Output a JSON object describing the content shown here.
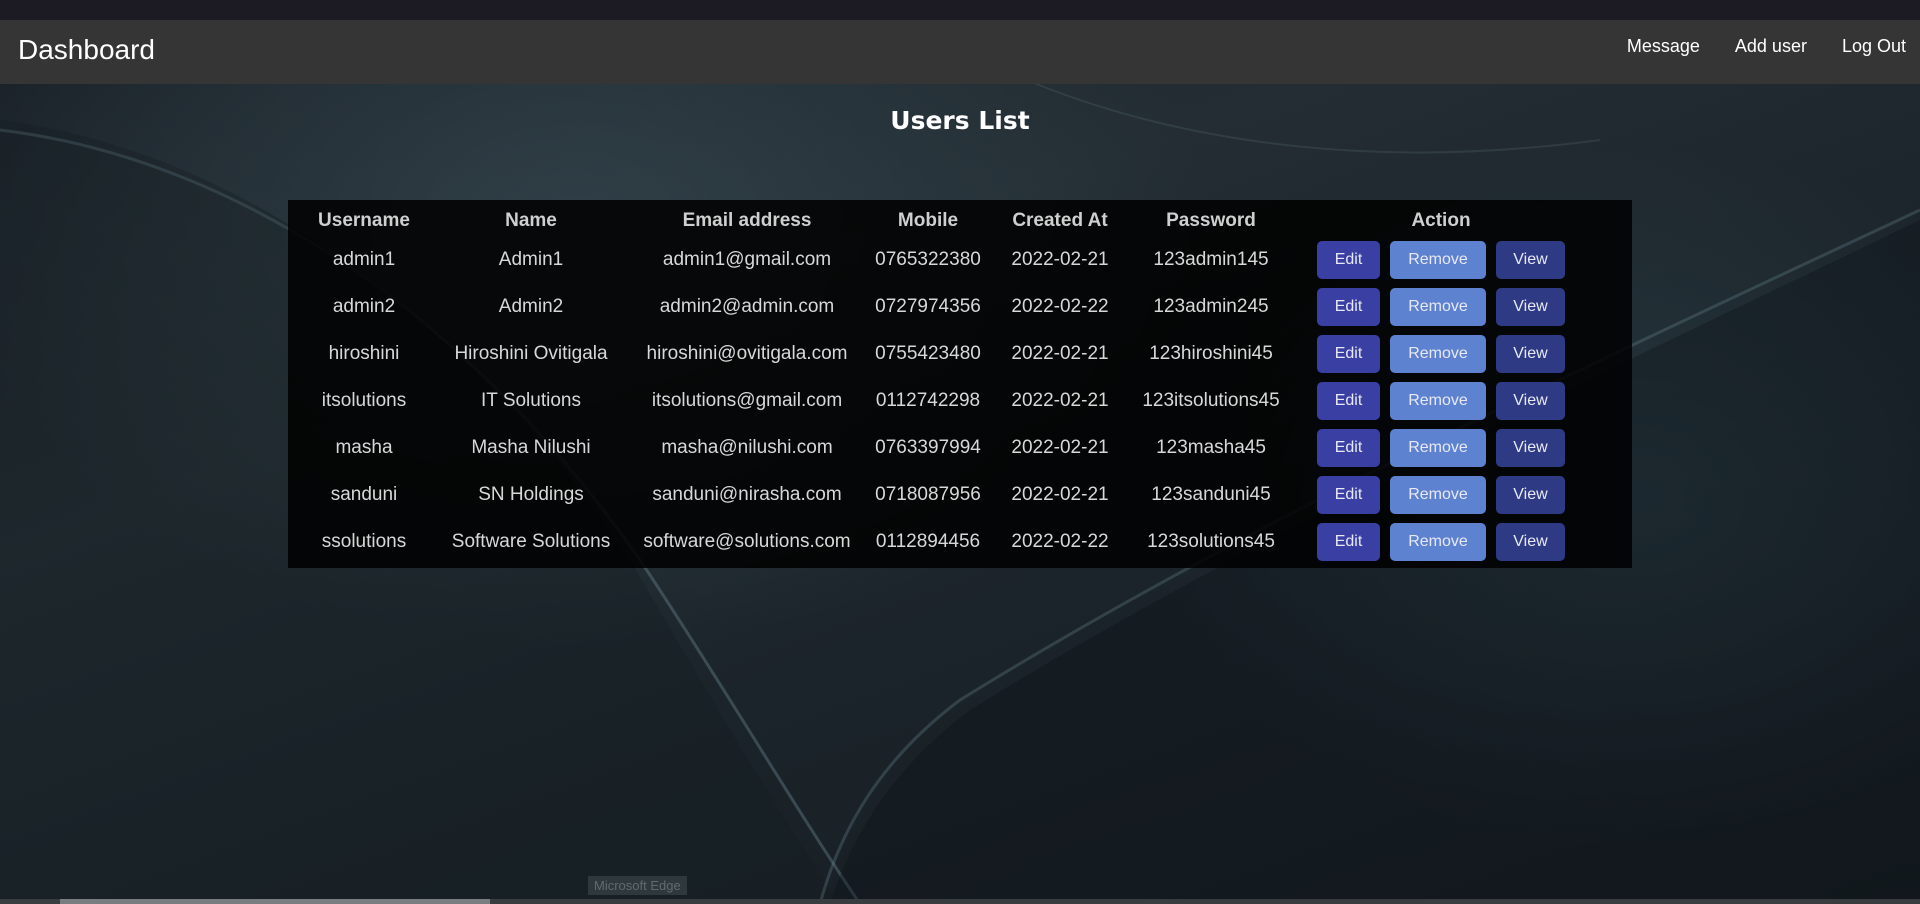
{
  "navbar": {
    "brand": "Dashboard",
    "links": [
      "Message",
      "Add user",
      "Log Out"
    ]
  },
  "page": {
    "title": "Users List"
  },
  "table": {
    "headers": [
      "Username",
      "Name",
      "Email address",
      "Mobile",
      "Created At",
      "Password",
      "Action"
    ],
    "rows": [
      [
        "admin1",
        "Admin1",
        "admin1@gmail.com",
        "0765322380",
        "2022-02-21",
        "123admin145"
      ],
      [
        "admin2",
        "Admin2",
        "admin2@admin.com",
        "0727974356",
        "2022-02-22",
        "123admin245"
      ],
      [
        "hiroshini",
        "Hiroshini Ovitigala",
        "hiroshini@ovitigala.com",
        "0755423480",
        "2022-02-21",
        "123hiroshini45"
      ],
      [
        "itsolutions",
        "IT Solutions",
        "itsolutions@gmail.com",
        "0112742298",
        "2022-02-21",
        "123itsolutions45"
      ],
      [
        "masha",
        "Masha Nilushi",
        "masha@nilushi.com",
        "0763397994",
        "2022-02-21",
        "123masha45"
      ],
      [
        "sanduni",
        "SN Holdings",
        "sanduni@nirasha.com",
        "0718087956",
        "2022-02-21",
        "123sanduni45"
      ],
      [
        "ssolutions",
        "Software Solutions",
        "software@solutions.com",
        "0112894456",
        "2022-02-22",
        "123solutions45"
      ]
    ],
    "action_labels": {
      "edit": "Edit",
      "remove": "Remove",
      "view": "View"
    }
  },
  "tooltip": "Microsoft Edge",
  "colors": {
    "navbar": "#353535",
    "edit_button": "#3a3fa3",
    "remove_button": "#5d82cf",
    "view_button": "#2f3a85"
  }
}
